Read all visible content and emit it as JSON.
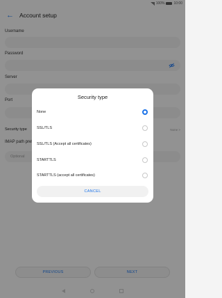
{
  "status_bar": {
    "signal": "signal-icon",
    "battery_text": "100%",
    "time": "10:00"
  },
  "app_bar": {
    "back_icon": "arrow-left-icon",
    "title": "Account setup"
  },
  "form": {
    "username_label": "Username",
    "password_label": "Password",
    "server_label": "Server",
    "port_label": "Port",
    "security_type_label": "Security type",
    "security_type_value": "None",
    "imap_path_label": "IMAP path prefix",
    "imap_path_placeholder": "Optional"
  },
  "bottom_buttons": {
    "previous": "PREVIOUS",
    "next": "NEXT"
  },
  "dialog": {
    "title": "Security type",
    "selected_index": 0,
    "options": [
      "None",
      "SSL/TLS",
      "SSL/TLS (Accept all certificates)",
      "STARTTLS",
      "STARTTLS (accept all certificates)"
    ],
    "cancel": "CANCEL"
  },
  "colors": {
    "accent": "#1b73e8",
    "scrim": "rgba(0,0,0,0.4)"
  }
}
